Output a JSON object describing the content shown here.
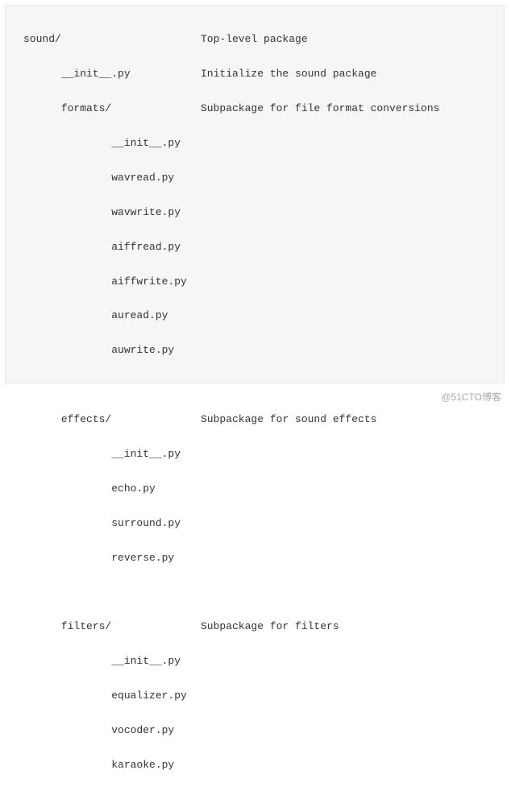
{
  "tree": {
    "root": {
      "name": "sound/",
      "comment": "Top-level package"
    },
    "init1": {
      "name": "__init__.py",
      "comment": "Initialize the sound package"
    },
    "formats": {
      "name": "formats/",
      "comment": "Subpackage for file format conversions"
    },
    "formats_files": {
      "f0": "__init__.py",
      "f1": "wavread.py",
      "f2": "wavwrite.py",
      "f3": "aiffread.py",
      "f4": "aiffwrite.py",
      "f5": "auread.py",
      "f6": "auwrite.py"
    },
    "effects": {
      "name": "effects/",
      "comment": "Subpackage for sound effects"
    },
    "effects_files": {
      "f0": "__init__.py",
      "f1": "echo.py",
      "f2": "surround.py",
      "f3": "reverse.py"
    },
    "filters": {
      "name": "filters/",
      "comment": "Subpackage for filters"
    },
    "filters_files": {
      "f0": "__init__.py",
      "f1": "equalizer.py",
      "f2": "vocoder.py",
      "f3": "karaoke.py"
    }
  },
  "watermark": "@51CTO博客"
}
